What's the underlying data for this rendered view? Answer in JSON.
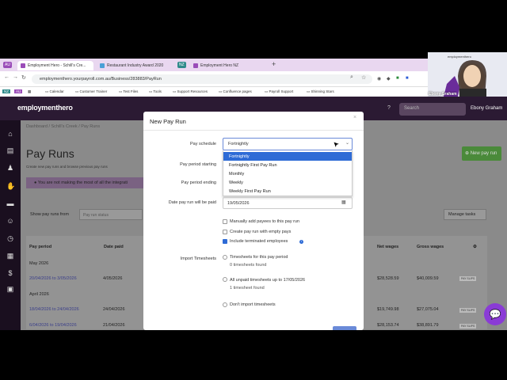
{
  "tabs": [
    {
      "label": "Employment Hero - Schill's Cre...",
      "badge": "AU",
      "badge_color": "#9a4cb8"
    },
    {
      "label": "Restaurant Industry Award 2020"
    },
    {
      "label": "Employment Hero NZ",
      "badge": "NZ",
      "badge_color": "#2e8a8a"
    }
  ],
  "new_tab": "+",
  "url": "employmenthero.yourpayroll.com.au/Business/283883/PayRun",
  "bookmarks": [
    "Calendar",
    "Customer Trainer",
    "Test Files",
    "Tools",
    "Support Resources",
    "Confluence pages",
    "Payroll Support",
    "Shinning Stars"
  ],
  "bookmark_badges": [
    "NZ",
    "AU"
  ],
  "app": {
    "logo": "employmenthero",
    "help": "?",
    "search_placeholder": "Search",
    "user": "Ebony Graham"
  },
  "page": {
    "breadcrumb": [
      "Dashboard",
      "Schill's Creek",
      "Pay Runs"
    ],
    "title": "Pay Runs",
    "subtitle": "Create new pay runs and browse previous pay runs",
    "banner": "You are not making the most of all the integrati",
    "new_pay_run": "⊕ New pay run",
    "show_label": "Show pay runs from",
    "status_placeholder": "Pay run status",
    "manage_tasks": "Manage tasks",
    "columns": [
      "Pay period",
      "Date paid",
      "Net wages",
      "Gross wages"
    ],
    "groups": [
      "May 2026",
      "April 2026"
    ],
    "rows": [
      {
        "period": "20/04/2026 to 3/05/2026",
        "date": "4/05/2026",
        "net": "$28,528.59",
        "gross": "$40,009.59",
        "slip": "PAY SLIPS"
      },
      {
        "period": "18/04/2026 to 24/04/2026",
        "date": "24/04/2026",
        "net": "$19,749.98",
        "gross": "$27,075.04",
        "slip": "PAY SLIPS"
      },
      {
        "period": "6/04/2026 to 19/04/2026",
        "date": "21/04/2026",
        "net": "$28,153.74",
        "gross": "$38,891.79",
        "slip": "PAY SLIPS"
      }
    ]
  },
  "modal": {
    "title": "New Pay Run",
    "close": "×",
    "labels": {
      "schedule": "Pay schedule",
      "start": "Pay period starting",
      "end": "Pay period ending",
      "paid": "Date pay run will be paid",
      "timesheets": "Import Timesheets"
    },
    "schedule_value": "Fortnightly",
    "options": [
      "Fortnightly",
      "Fortnightly First Pay Run",
      "Monthly",
      "Weekly",
      "Weekly First Pay Run"
    ],
    "selected_index": 0,
    "paid_date": "19/05/2026",
    "checkboxes": [
      {
        "label": "Manually add payees to this pay run",
        "checked": false
      },
      {
        "label": "Create pay run with empty pays",
        "checked": false
      },
      {
        "label": "Include terminated employees",
        "checked": true
      }
    ],
    "radios": [
      {
        "label": "Timesheets for this pay period",
        "sub": "0 timesheets found"
      },
      {
        "label": "All unpaid timesheets up to 17/05/2026",
        "sub": "1 timesheet found"
      },
      {
        "label": "Don't import timesheets",
        "sub": ""
      }
    ]
  },
  "webcam": {
    "brand": "employmenthero",
    "name": "Ebony Graham"
  }
}
